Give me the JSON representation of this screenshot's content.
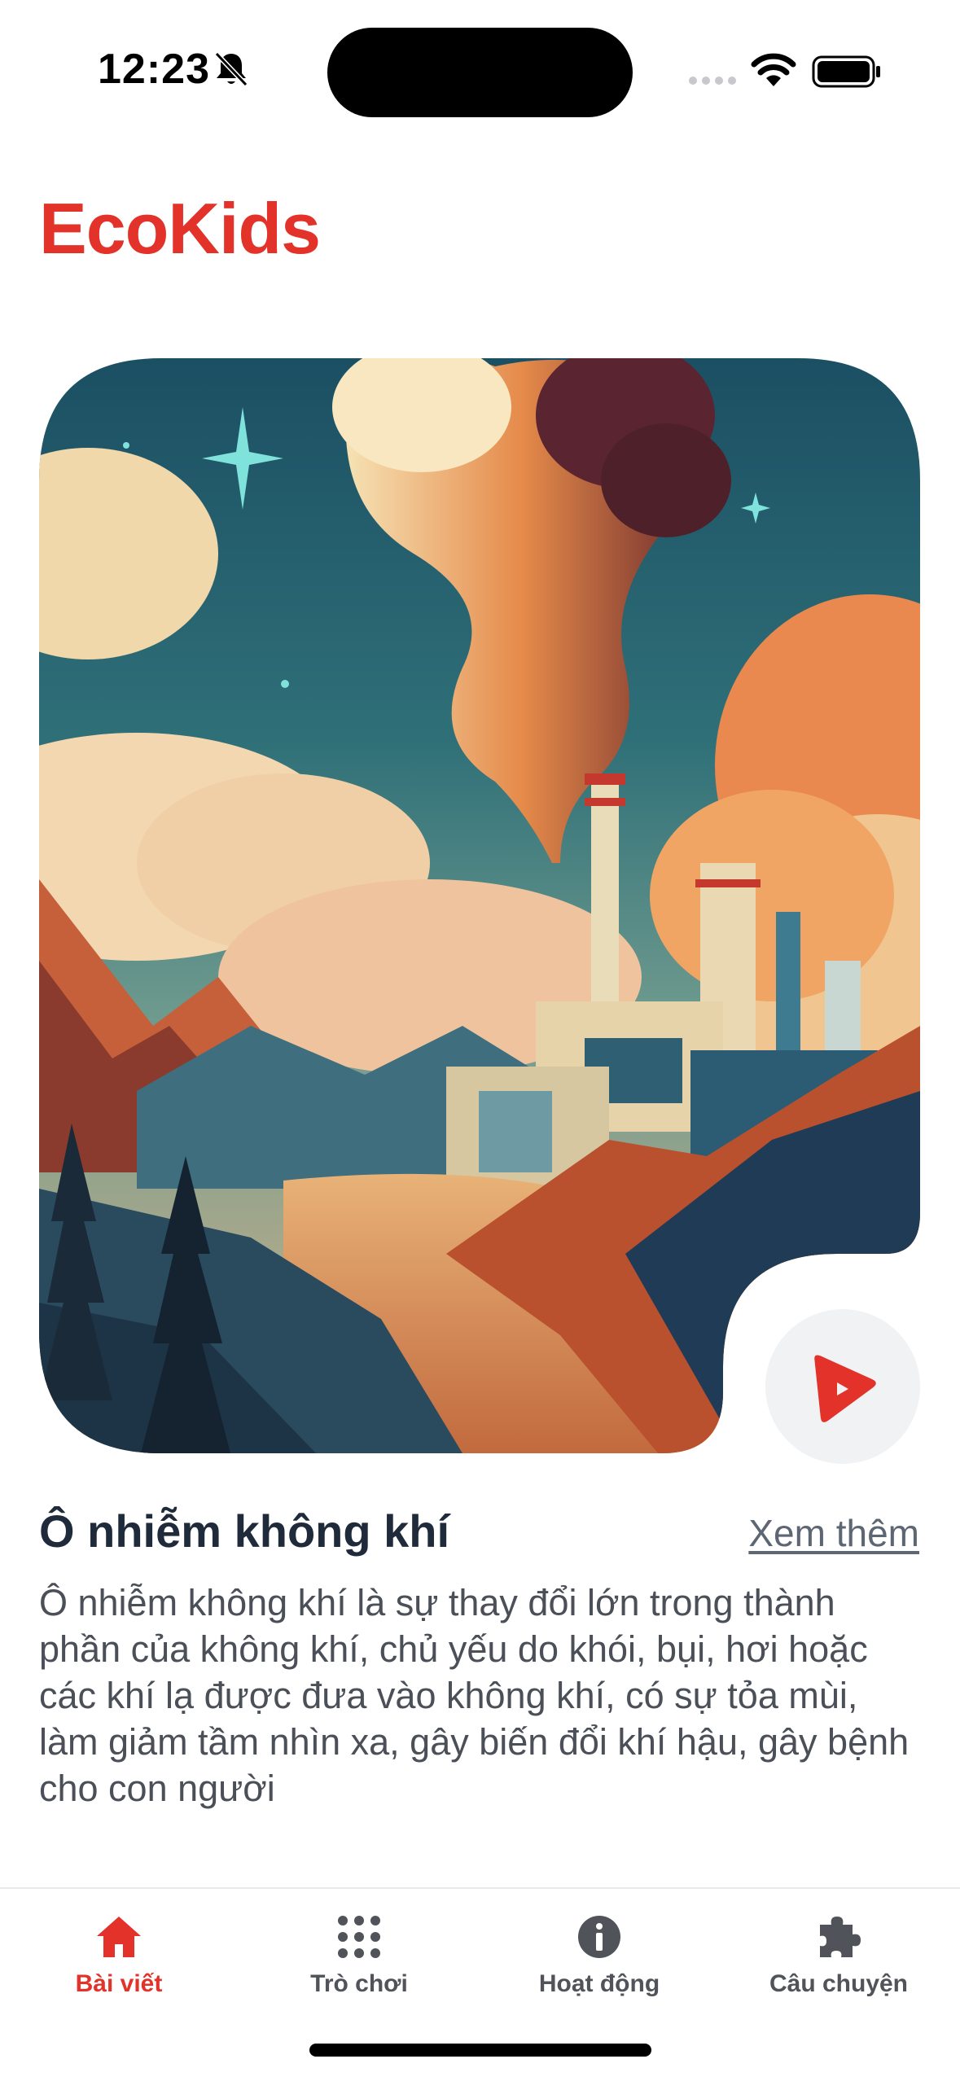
{
  "status_bar": {
    "time": "12:23",
    "icons": [
      "bell-slash-icon",
      "cellular-signal-icon",
      "wifi-icon",
      "battery-icon"
    ]
  },
  "app": {
    "title": "EcoKids",
    "accent_color": "#e2322a"
  },
  "hero": {
    "image_subject": "factory-smokestacks-pollution-illustration",
    "play_icon": "play-icon"
  },
  "article": {
    "title": "Ô nhiễm không khí",
    "see_more": "Xem thêm",
    "body": "Ô nhiễm không khí là sự thay đổi lớn trong thành phần của không khí, chủ yếu do khói, bụi, hơi hoặc các khí lạ được đưa vào không khí, có sự tỏa mùi, làm giảm tầm nhìn xa, gây biến đổi khí hậu, gây bệnh cho con người"
  },
  "tabs": [
    {
      "label": "Bài viết",
      "icon": "home-icon",
      "active": true
    },
    {
      "label": "Trò chơi",
      "icon": "grid-dots-icon",
      "active": false
    },
    {
      "label": "Hoạt động",
      "icon": "info-icon",
      "active": false
    },
    {
      "label": "Câu chuyện",
      "icon": "puzzle-icon",
      "active": false
    }
  ]
}
